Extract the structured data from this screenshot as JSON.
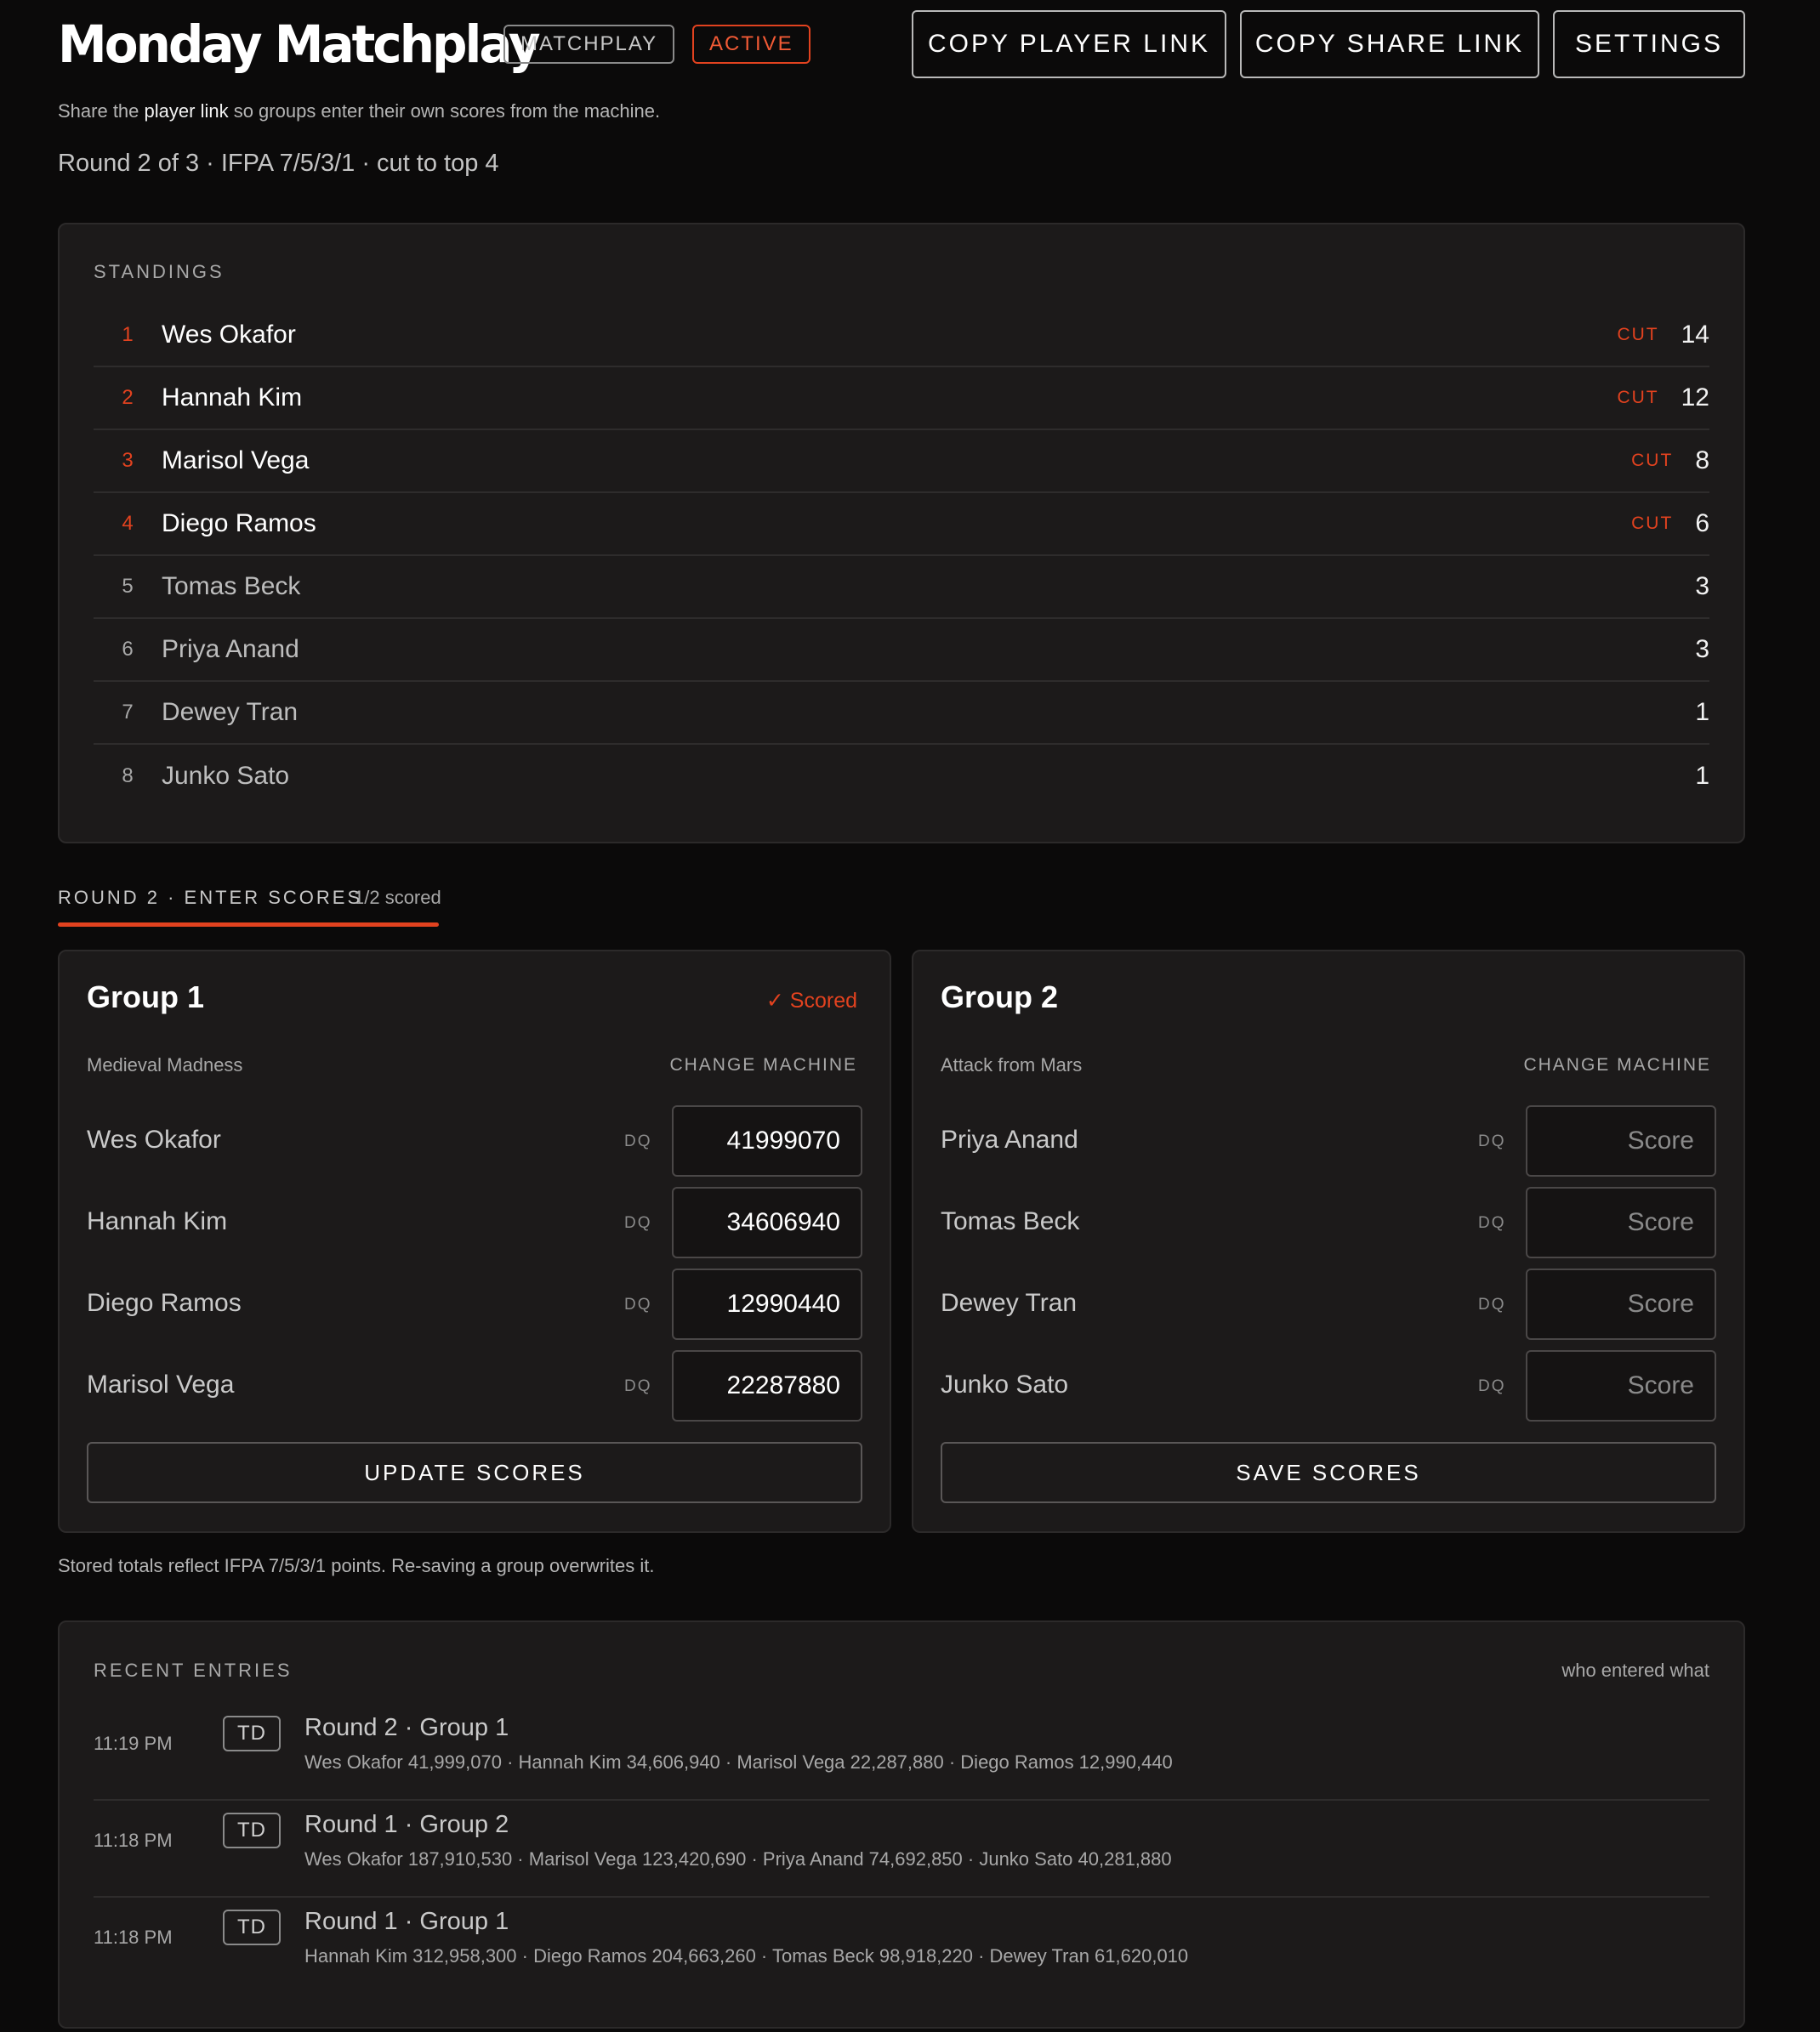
{
  "header": {
    "title": "Monday Matchplay",
    "mode_badge": "MATCHPLAY",
    "status_badge": "ACTIVE",
    "buttons": {
      "copy_player_link": "COPY PLAYER LINK",
      "copy_share_link": "COPY SHARE LINK",
      "settings": "SETTINGS"
    },
    "hint_prefix": "Share the",
    "hint_link": "player link",
    "hint_suffix": "so groups enter their own scores from the machine.",
    "meta": "Round 2 of 3 · IFPA 7/5/3/1 · cut to top 4"
  },
  "standings": {
    "label": "STANDINGS",
    "cut_label": "CUT",
    "rows": [
      {
        "rank": "1",
        "name": "Wes Okafor",
        "cut": true,
        "points": "14"
      },
      {
        "rank": "2",
        "name": "Hannah Kim",
        "cut": true,
        "points": "12"
      },
      {
        "rank": "3",
        "name": "Marisol Vega",
        "cut": true,
        "points": "8"
      },
      {
        "rank": "4",
        "name": "Diego Ramos",
        "cut": true,
        "points": "6"
      },
      {
        "rank": "5",
        "name": "Tomas Beck",
        "cut": false,
        "points": "3"
      },
      {
        "rank": "6",
        "name": "Priya Anand",
        "cut": false,
        "points": "3"
      },
      {
        "rank": "7",
        "name": "Dewey Tran",
        "cut": false,
        "points": "1"
      },
      {
        "rank": "8",
        "name": "Junko Sato",
        "cut": false,
        "points": "1"
      }
    ]
  },
  "round": {
    "tab_label": "ROUND 2 · ENTER SCORES",
    "progress": "1/2 scored",
    "groups": [
      {
        "title": "Group 1",
        "status": "✓ Scored",
        "machine": "Medieval Madness",
        "change_machine": "CHANGE MACHINE",
        "dq_label": "DQ",
        "players": [
          {
            "name": "Wes Okafor",
            "score": "41999070"
          },
          {
            "name": "Hannah Kim",
            "score": "34606940"
          },
          {
            "name": "Diego Ramos",
            "score": "12990440"
          },
          {
            "name": "Marisol Vega",
            "score": "22287880"
          }
        ],
        "score_placeholder": "Score",
        "button": "UPDATE SCORES"
      },
      {
        "title": "Group 2",
        "status": "",
        "machine": "Attack from Mars",
        "change_machine": "CHANGE MACHINE",
        "dq_label": "DQ",
        "players": [
          {
            "name": "Priya Anand",
            "score": ""
          },
          {
            "name": "Tomas Beck",
            "score": ""
          },
          {
            "name": "Dewey Tran",
            "score": ""
          },
          {
            "name": "Junko Sato",
            "score": ""
          }
        ],
        "score_placeholder": "Score",
        "button": "SAVE SCORES"
      }
    ],
    "footnote": "Stored totals reflect IFPA 7/5/3/1 points. Re-saving a group overwrites it."
  },
  "recent": {
    "label": "RECENT ENTRIES",
    "aside": "who entered what",
    "entries": [
      {
        "time": "11:19 PM",
        "tag": "TD",
        "title": "Round 2 · Group 1",
        "detail": "Wes Okafor 41,999,070 · Hannah Kim 34,606,940 · Marisol Vega 22,287,880 · Diego Ramos 12,990,440"
      },
      {
        "time": "11:18 PM",
        "tag": "TD",
        "title": "Round 1 · Group 2",
        "detail": "Wes Okafor 187,910,530 · Marisol Vega 123,420,690 · Priya Anand 74,692,850 · Junko Sato 40,281,880"
      },
      {
        "time": "11:18 PM",
        "tag": "TD",
        "title": "Round 1 · Group 1",
        "detail": "Hannah Kim 312,958,300 · Diego Ramos 204,663,260 · Tomas Beck 98,918,220 · Dewey Tran 61,620,010"
      }
    ]
  },
  "colors": {
    "accent": "#e2421f",
    "background": "#0b0a0a",
    "panel": "#1c1a1a"
  }
}
